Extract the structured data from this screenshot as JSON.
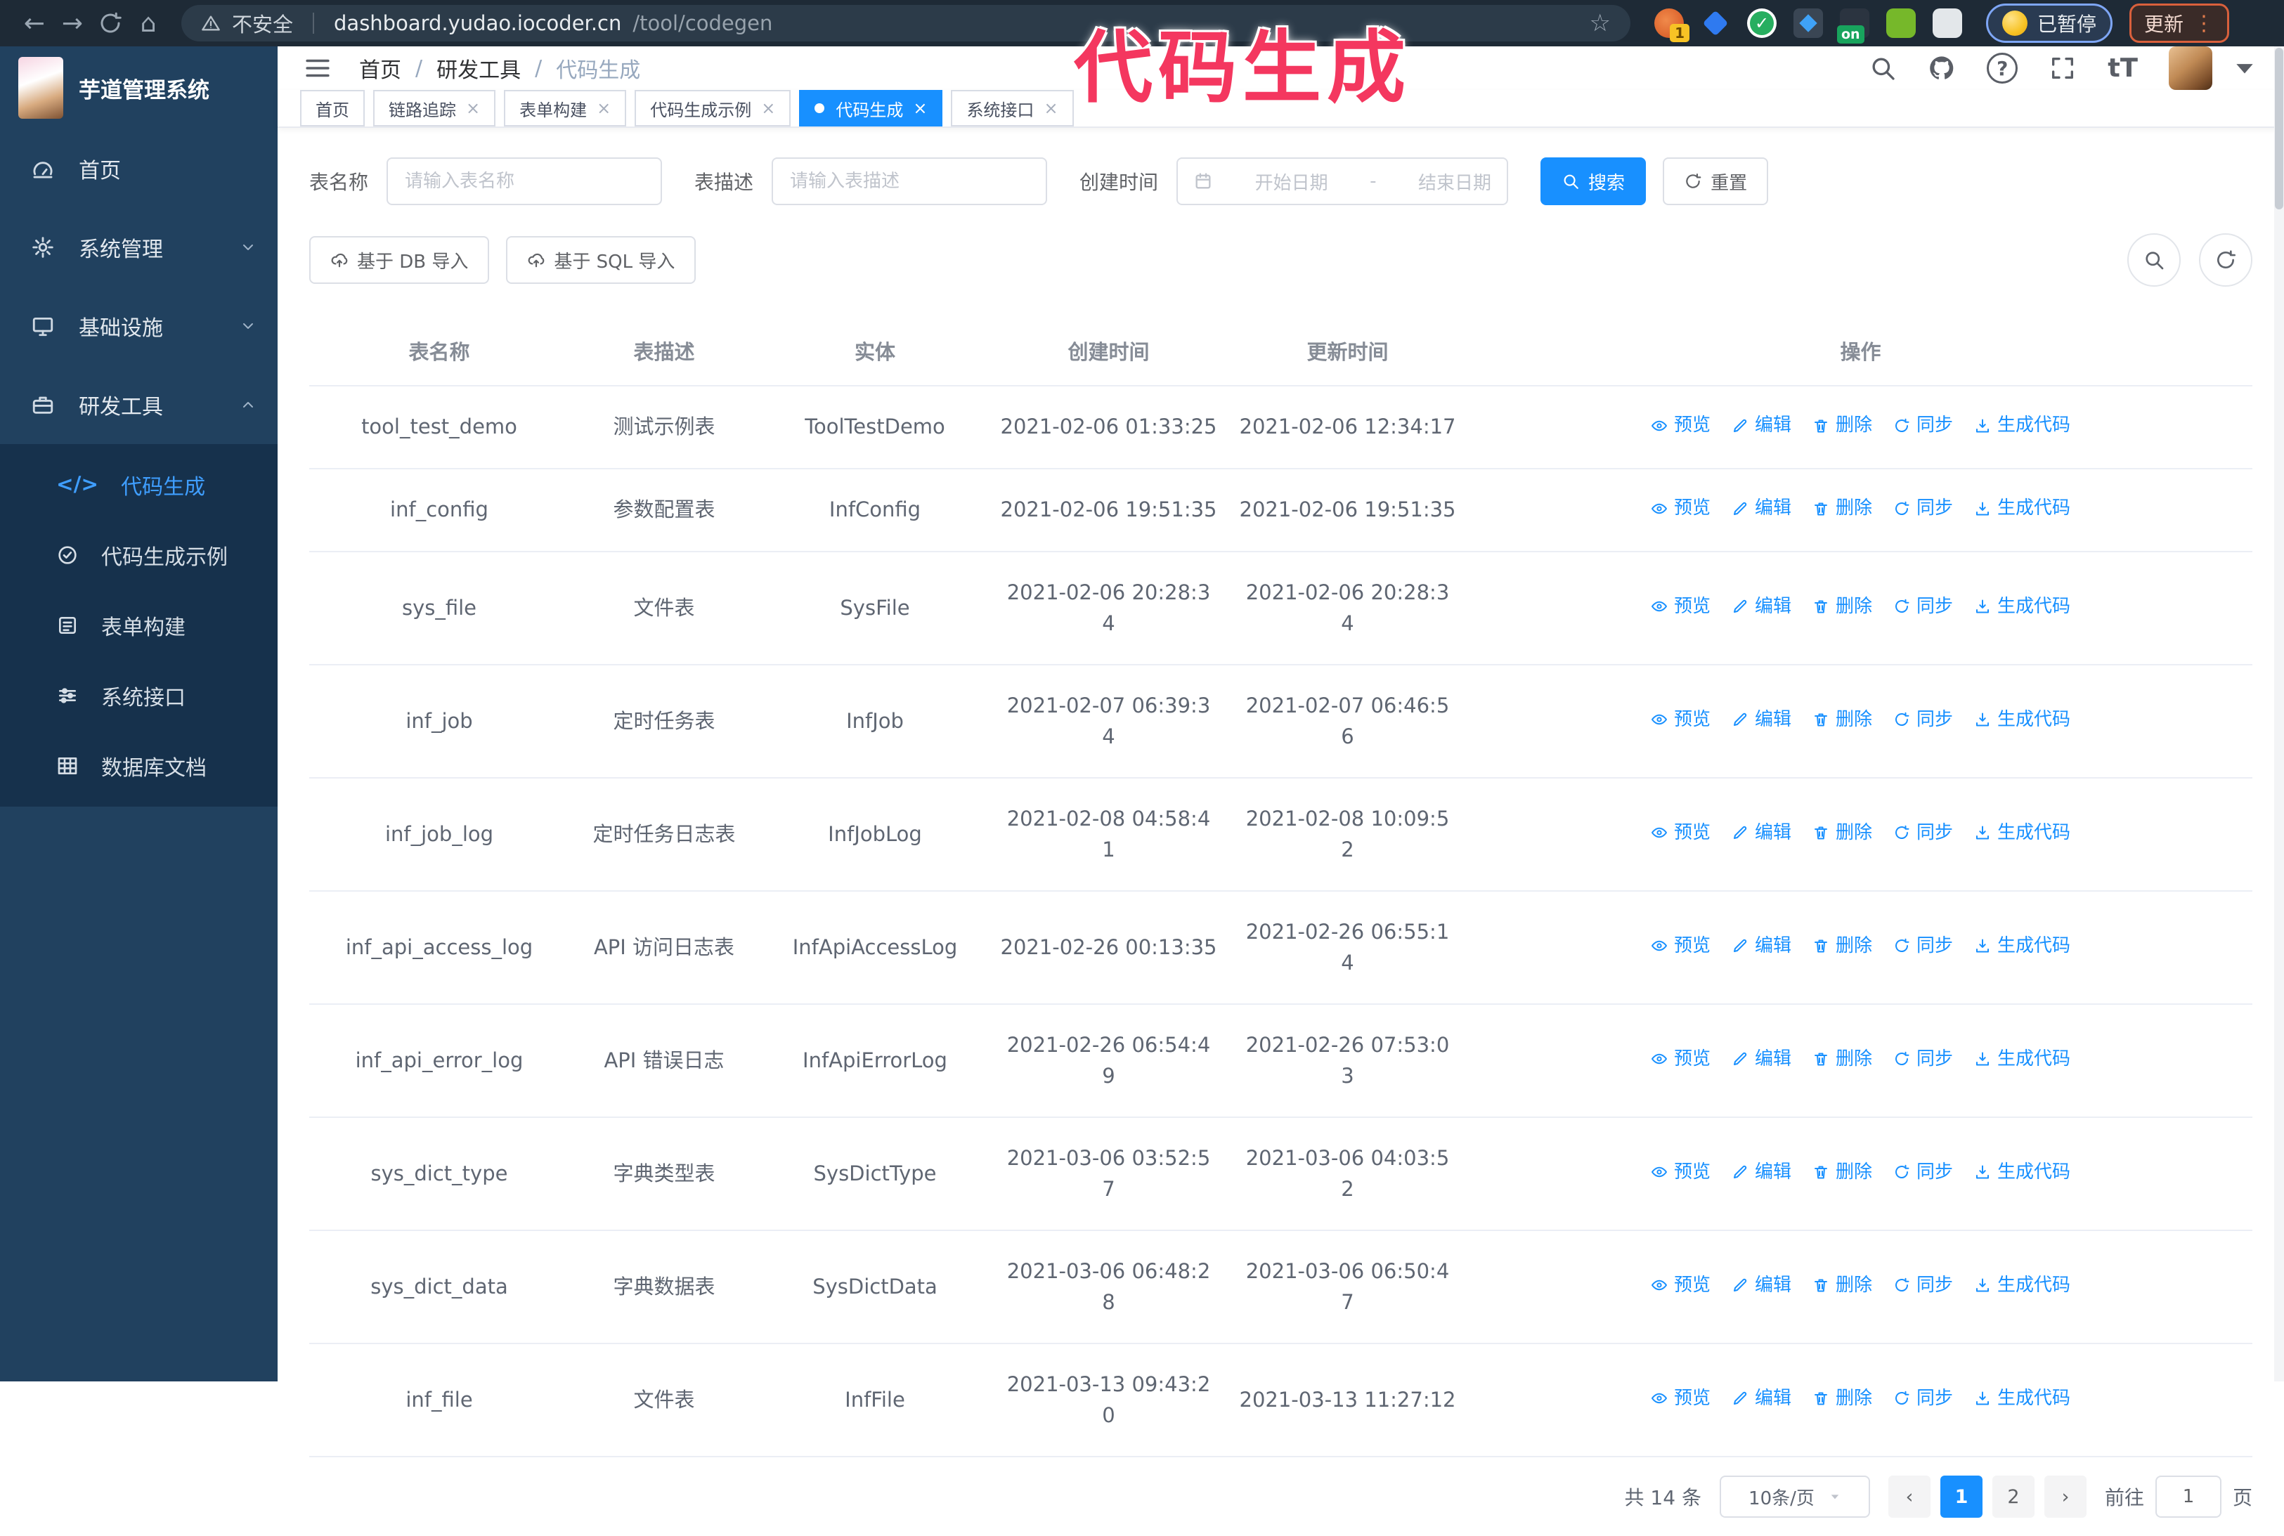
{
  "browser": {
    "security_label": "不安全",
    "url_host": "dashboard.yudao.iocoder.cn",
    "url_path": "/tool/codegen",
    "extension_badge": "1",
    "extension_on_badge": "on",
    "paused_badge": "已暂停",
    "update_label": "更新"
  },
  "annotation": {
    "text": "代码生成",
    "color": "#f4375f"
  },
  "colors": {
    "accent": "#1890ff",
    "sidebar_bg": "#21415f",
    "submenu_bg": "#16314c",
    "chrome_bg": "#1e2a36"
  },
  "sidebar": {
    "logo_title": "芋道管理系统",
    "items": [
      {
        "label": "首页",
        "icon": "dashboard-icon",
        "arrow": ""
      },
      {
        "label": "系统管理",
        "icon": "gear-icon",
        "arrow": "down"
      },
      {
        "label": "基础设施",
        "icon": "monitor-icon",
        "arrow": "down"
      },
      {
        "label": "研发工具",
        "icon": "briefcase-icon",
        "arrow": "up"
      }
    ],
    "submenu": [
      {
        "label": "代码生成",
        "icon": "code-icon",
        "active": true
      },
      {
        "label": "代码生成示例",
        "icon": "badge-check-icon",
        "active": false
      },
      {
        "label": "表单构建",
        "icon": "form-icon",
        "active": false
      },
      {
        "label": "系统接口",
        "icon": "sliders-icon",
        "active": false
      },
      {
        "label": "数据库文档",
        "icon": "table-icon",
        "active": false
      }
    ]
  },
  "navbar": {
    "breadcrumb": [
      {
        "label": "首页"
      },
      {
        "label": "研发工具"
      },
      {
        "label": "代码生成"
      }
    ]
  },
  "tabs": [
    {
      "label": "首页",
      "closable": false,
      "active": false
    },
    {
      "label": "链路追踪",
      "closable": true,
      "active": false
    },
    {
      "label": "表单构建",
      "closable": true,
      "active": false
    },
    {
      "label": "代码生成示例",
      "closable": true,
      "active": false
    },
    {
      "label": "代码生成",
      "closable": true,
      "active": true
    },
    {
      "label": "系统接口",
      "closable": true,
      "active": false
    }
  ],
  "filters": {
    "table_name_label": "表名称",
    "table_name_placeholder": "请输入表名称",
    "table_desc_label": "表描述",
    "table_desc_placeholder": "请输入表描述",
    "create_time_label": "创建时间",
    "date_start_placeholder": "开始日期",
    "date_separator": "-",
    "date_end_placeholder": "结束日期",
    "search_label": "搜索",
    "reset_label": "重置"
  },
  "toolbar": {
    "import_db_label": "基于 DB 导入",
    "import_sql_label": "基于 SQL 导入"
  },
  "table": {
    "columns": [
      "表名称",
      "表描述",
      "实体",
      "创建时间",
      "更新时间",
      "操作"
    ],
    "action_labels": [
      "预览",
      "编辑",
      "删除",
      "同步",
      "生成代码"
    ],
    "action_icons": [
      "eye-icon",
      "edit-icon",
      "delete-icon",
      "sync-icon",
      "download-icon"
    ],
    "rows": [
      {
        "name": "tool_test_demo",
        "desc": "测试示例表",
        "entity": "ToolTestDemo",
        "create": "2021-02-06 01:33:25",
        "update": "2021-02-06 12:34:17"
      },
      {
        "name": "inf_config",
        "desc": "参数配置表",
        "entity": "InfConfig",
        "create": "2021-02-06 19:51:35",
        "update": "2021-02-06 19:51:35"
      },
      {
        "name": "sys_file",
        "desc": "文件表",
        "entity": "SysFile",
        "create": "2021-02-06 20:28:3\n4",
        "update": "2021-02-06 20:28:3\n4"
      },
      {
        "name": "inf_job",
        "desc": "定时任务表",
        "entity": "InfJob",
        "create": "2021-02-07 06:39:3\n4",
        "update": "2021-02-07 06:46:5\n6"
      },
      {
        "name": "inf_job_log",
        "desc": "定时任务日志表",
        "entity": "InfJobLog",
        "create": "2021-02-08 04:58:4\n1",
        "update": "2021-02-08 10:09:5\n2"
      },
      {
        "name": "inf_api_access_log",
        "desc": "API 访问日志表",
        "entity": "InfApiAccessLog",
        "create": "2021-02-26 00:13:35",
        "update": "2021-02-26 06:55:1\n4"
      },
      {
        "name": "inf_api_error_log",
        "desc": "API 错误日志",
        "entity": "InfApiErrorLog",
        "create": "2021-02-26 06:54:4\n9",
        "update": "2021-02-26 07:53:0\n3"
      },
      {
        "name": "sys_dict_type",
        "desc": "字典类型表",
        "entity": "SysDictType",
        "create": "2021-03-06 03:52:5\n7",
        "update": "2021-03-06 04:03:5\n2"
      },
      {
        "name": "sys_dict_data",
        "desc": "字典数据表",
        "entity": "SysDictData",
        "create": "2021-03-06 06:48:2\n8",
        "update": "2021-03-06 06:50:4\n7"
      },
      {
        "name": "inf_file",
        "desc": "文件表",
        "entity": "InfFile",
        "create": "2021-03-13 09:43:2\n0",
        "update": "2021-03-13 11:27:12"
      }
    ]
  },
  "pagination": {
    "total": "共 14 条",
    "page_size": "10条/页",
    "pages": [
      "1",
      "2"
    ],
    "active_page": "1",
    "goto_label": "前往",
    "goto_value": "1",
    "goto_suffix": "页"
  }
}
